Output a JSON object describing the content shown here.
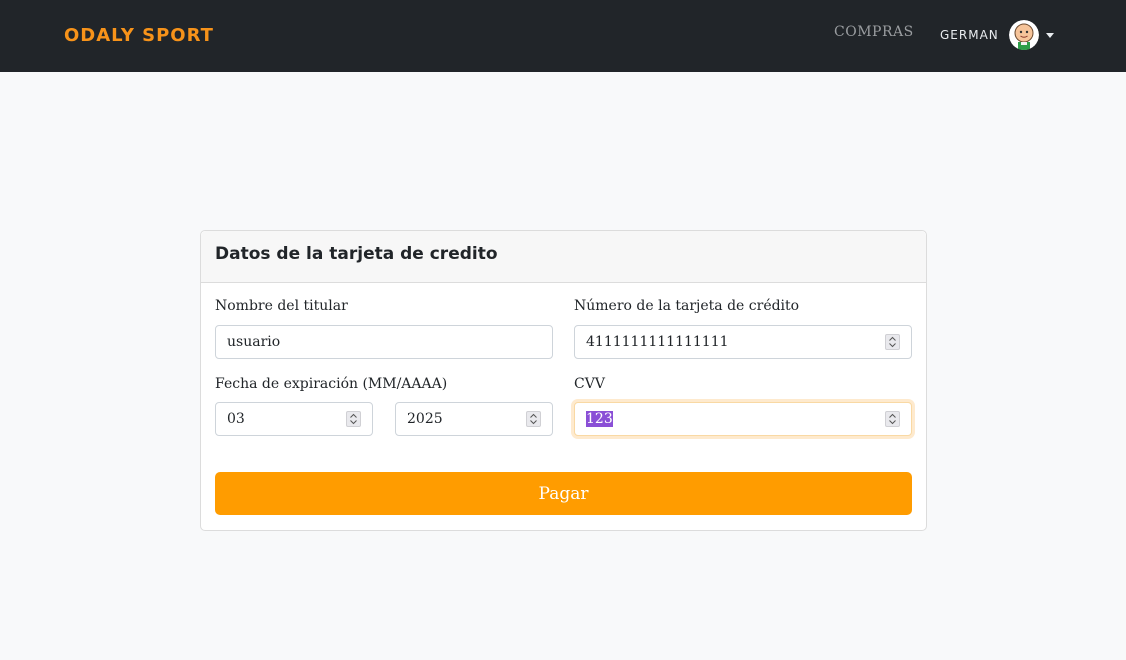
{
  "navbar": {
    "brand": "ODALY SPORT",
    "links": [
      {
        "label": "COMPRAS"
      }
    ],
    "user": {
      "name": "GERMAN"
    }
  },
  "card": {
    "title": "Datos de la tarjeta de credito",
    "fields": {
      "holder": {
        "label": "Nombre del titular",
        "value": "usuario"
      },
      "card_number": {
        "label": "Número de la tarjeta de crédito",
        "value": "4111111111111111"
      },
      "expiration": {
        "label": "Fecha de expiración (MM/AAAA)",
        "month": "03",
        "year": "2025"
      },
      "cvv": {
        "label": "CVV",
        "value": "123"
      }
    },
    "submit_label": "Pagar"
  },
  "colors": {
    "navbar_bg": "#212529",
    "brand": "#f7931a",
    "primary_button": "#ff9c00"
  }
}
